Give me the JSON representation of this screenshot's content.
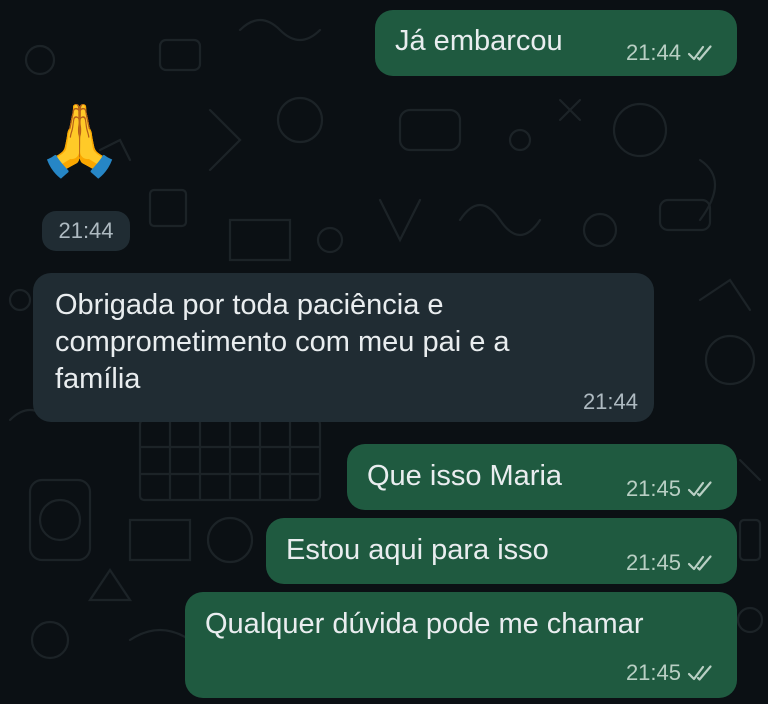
{
  "messages": [
    {
      "type": "outgoing",
      "text": "Já embarcou",
      "time": "21:44",
      "status": "read"
    },
    {
      "type": "incoming",
      "emoji": "🙏",
      "time": "21:44"
    },
    {
      "type": "incoming",
      "lines": [
        "Obrigada por toda paciência e",
        "comprometimento com meu pai e a",
        "família"
      ],
      "time": "21:44"
    },
    {
      "type": "outgoing",
      "text": "Que isso Maria",
      "time": "21:45",
      "status": "read"
    },
    {
      "type": "outgoing",
      "text": "Estou aqui para isso",
      "time": "21:45",
      "status": "read"
    },
    {
      "type": "outgoing",
      "text": "Qualquer dúvida pode me chamar",
      "time": "21:45",
      "status": "read"
    }
  ],
  "colors": {
    "background": "#0b1014",
    "outgoing_bubble": "#1f5a40",
    "incoming_bubble": "#202c33",
    "text": "#e9edef",
    "meta": "#aebac1"
  },
  "icons": {
    "read_receipt": "double-check-icon",
    "wallpaper": "doodle-pattern"
  }
}
